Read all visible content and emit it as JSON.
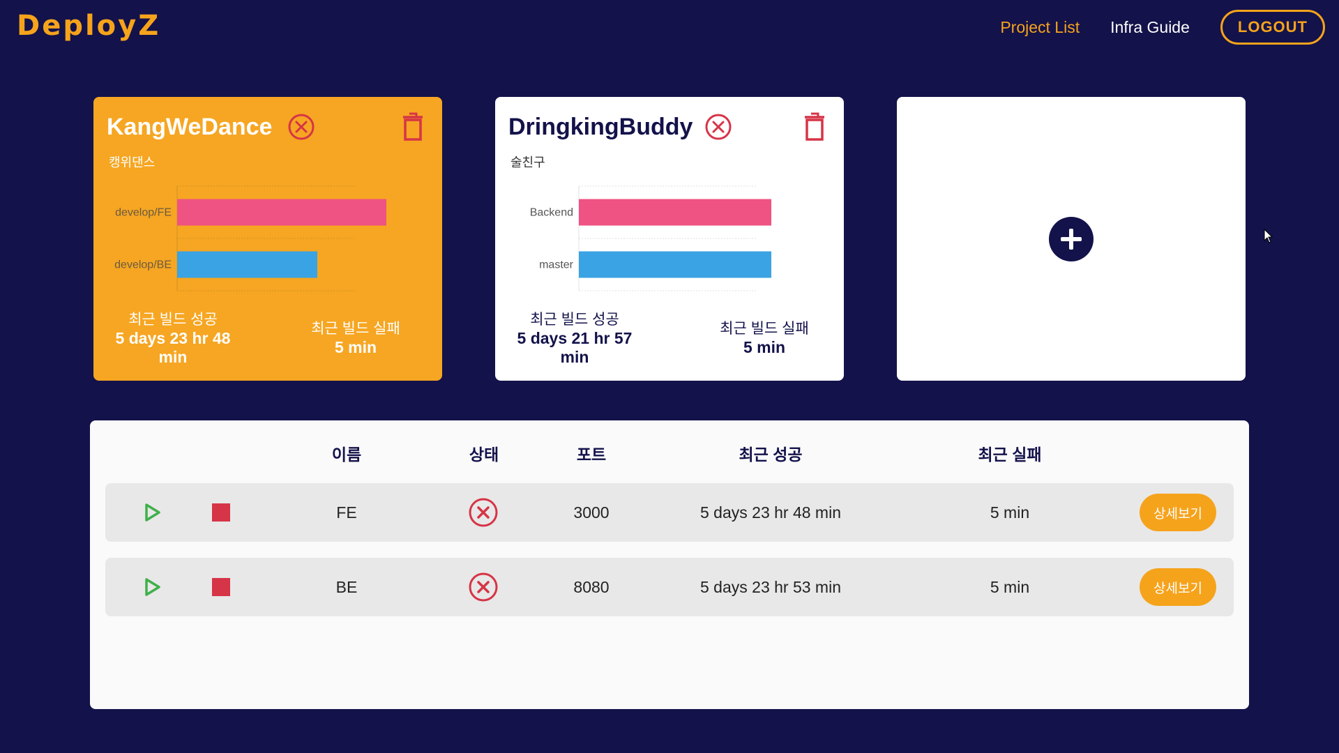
{
  "header": {
    "logo": "DeployZ",
    "nav": [
      "Project List",
      "Infra Guide"
    ],
    "logout": "LOGOUT"
  },
  "projects": [
    {
      "title": "KangWeDance",
      "subtitle": "캥위댄스",
      "chart_data": {
        "type": "bar",
        "orientation": "horizontal",
        "categories": [
          "develop/FE",
          "develop/BE"
        ],
        "values": [
          100,
          67
        ],
        "colors": [
          "#ef5383",
          "#3aa3e3"
        ]
      },
      "success_label": "최근 빌드 성공",
      "success_value": "5 days 23 hr 48 min",
      "fail_label": "최근 빌드 실패",
      "fail_value": "5 min"
    },
    {
      "title": "DringkingBuddy",
      "subtitle": "술친구",
      "chart_data": {
        "type": "bar",
        "orientation": "horizontal",
        "categories": [
          "Backend",
          "master"
        ],
        "values": [
          100,
          100
        ],
        "colors": [
          "#ef5383",
          "#3aa3e3"
        ]
      },
      "success_label": "최근 빌드 성공",
      "success_value": "5 days 21 hr 57 min",
      "fail_label": "최근 빌드 실패",
      "fail_value": "5 min"
    }
  ],
  "add_project_icon": "plus-icon",
  "table": {
    "headers": [
      "이름",
      "상태",
      "포트",
      "최근 성공",
      "최근 실패"
    ],
    "rows": [
      {
        "name": "FE",
        "status": "error",
        "port": "3000",
        "last_success": "5 days 23 hr 48 min",
        "last_fail": "5 min",
        "detail": "상세보기"
      },
      {
        "name": "BE",
        "status": "error",
        "port": "8080",
        "last_success": "5 days 23 hr 53 min",
        "last_fail": "5 min",
        "detail": "상세보기"
      }
    ]
  },
  "colors": {
    "background": "#13124a",
    "accent": "#f6a31c",
    "error": "#d63447",
    "play": "#3fb04a",
    "bar_pink": "#ef5383",
    "bar_blue": "#3aa3e3"
  }
}
